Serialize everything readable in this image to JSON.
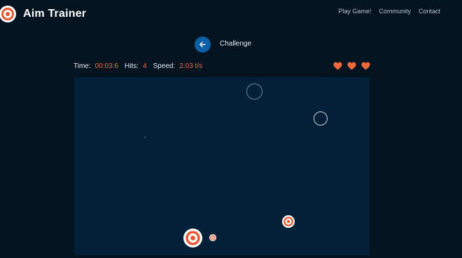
{
  "header": {
    "app_title": "Aim Trainer",
    "logo_icon": "target-icon",
    "nav": [
      "Play Game!",
      "Community",
      "Contact"
    ]
  },
  "mode": {
    "back_icon": "arrow-left-icon",
    "title": "Challenge"
  },
  "stats": {
    "time_label": "Time:",
    "time_value": "00:03:6",
    "hits_label": "Hits:",
    "hits_value": "4",
    "speed_label": "Speed:",
    "speed_value": "2.03 t/s"
  },
  "lives": {
    "count": 3,
    "icon": "heart-icon"
  },
  "colors": {
    "background": "#03131f",
    "arena": "#022138",
    "accent": "#f06a3c",
    "button": "#0d5fa6",
    "target_red": "#e8552e",
    "target_white": "#ffffff"
  }
}
